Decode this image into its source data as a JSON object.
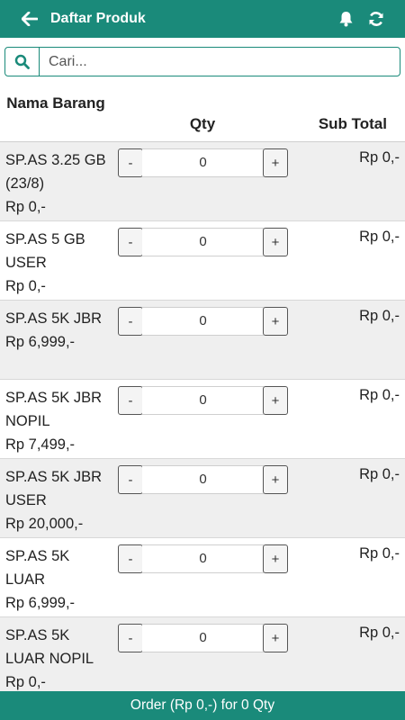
{
  "header": {
    "title": "Daftar Produk"
  },
  "search": {
    "placeholder": "Cari..."
  },
  "table": {
    "col_name": "Nama Barang",
    "col_qty": "Qty",
    "col_subtotal": "Sub Total"
  },
  "products": [
    {
      "name": "SP.AS 3.25 GB (23/8)",
      "price": "Rp 0,-",
      "qty": "0",
      "subtotal": "Rp 0,-",
      "minus": "-",
      "plus": "+"
    },
    {
      "name": "SP.AS 5 GB USER",
      "price": "Rp 0,-",
      "qty": "0",
      "subtotal": "Rp 0,-",
      "minus": "-",
      "plus": "+"
    },
    {
      "name": "SP.AS 5K JBR",
      "price": "Rp 6,999,-",
      "qty": "0",
      "subtotal": "Rp 0,-",
      "minus": "-",
      "plus": "+"
    },
    {
      "name": "SP.AS 5K JBR NOPIL",
      "price": "Rp 7,499,-",
      "qty": "0",
      "subtotal": "Rp 0,-",
      "minus": "-",
      "plus": "+"
    },
    {
      "name": "SP.AS 5K JBR USER",
      "price": "Rp 20,000,-",
      "qty": "0",
      "subtotal": "Rp 0,-",
      "minus": "-",
      "plus": "+"
    },
    {
      "name": "SP.AS 5K LUAR",
      "price": "Rp 6,999,-",
      "qty": "0",
      "subtotal": "Rp 0,-",
      "minus": "-",
      "plus": "+"
    },
    {
      "name": "SP.AS 5K LUAR NOPIL",
      "price": "Rp 0,-",
      "qty": "0",
      "subtotal": "Rp 0,-",
      "minus": "-",
      "plus": "+"
    }
  ],
  "footer": {
    "order_label": "Order (Rp 0,-) for 0 Qty"
  },
  "colors": {
    "primary": "#1a8a7a",
    "row_alt": "#efefef"
  },
  "icons": {
    "back": "arrow-left-icon",
    "bell": "bell-icon",
    "refresh": "refresh-icon",
    "search": "search-icon"
  }
}
